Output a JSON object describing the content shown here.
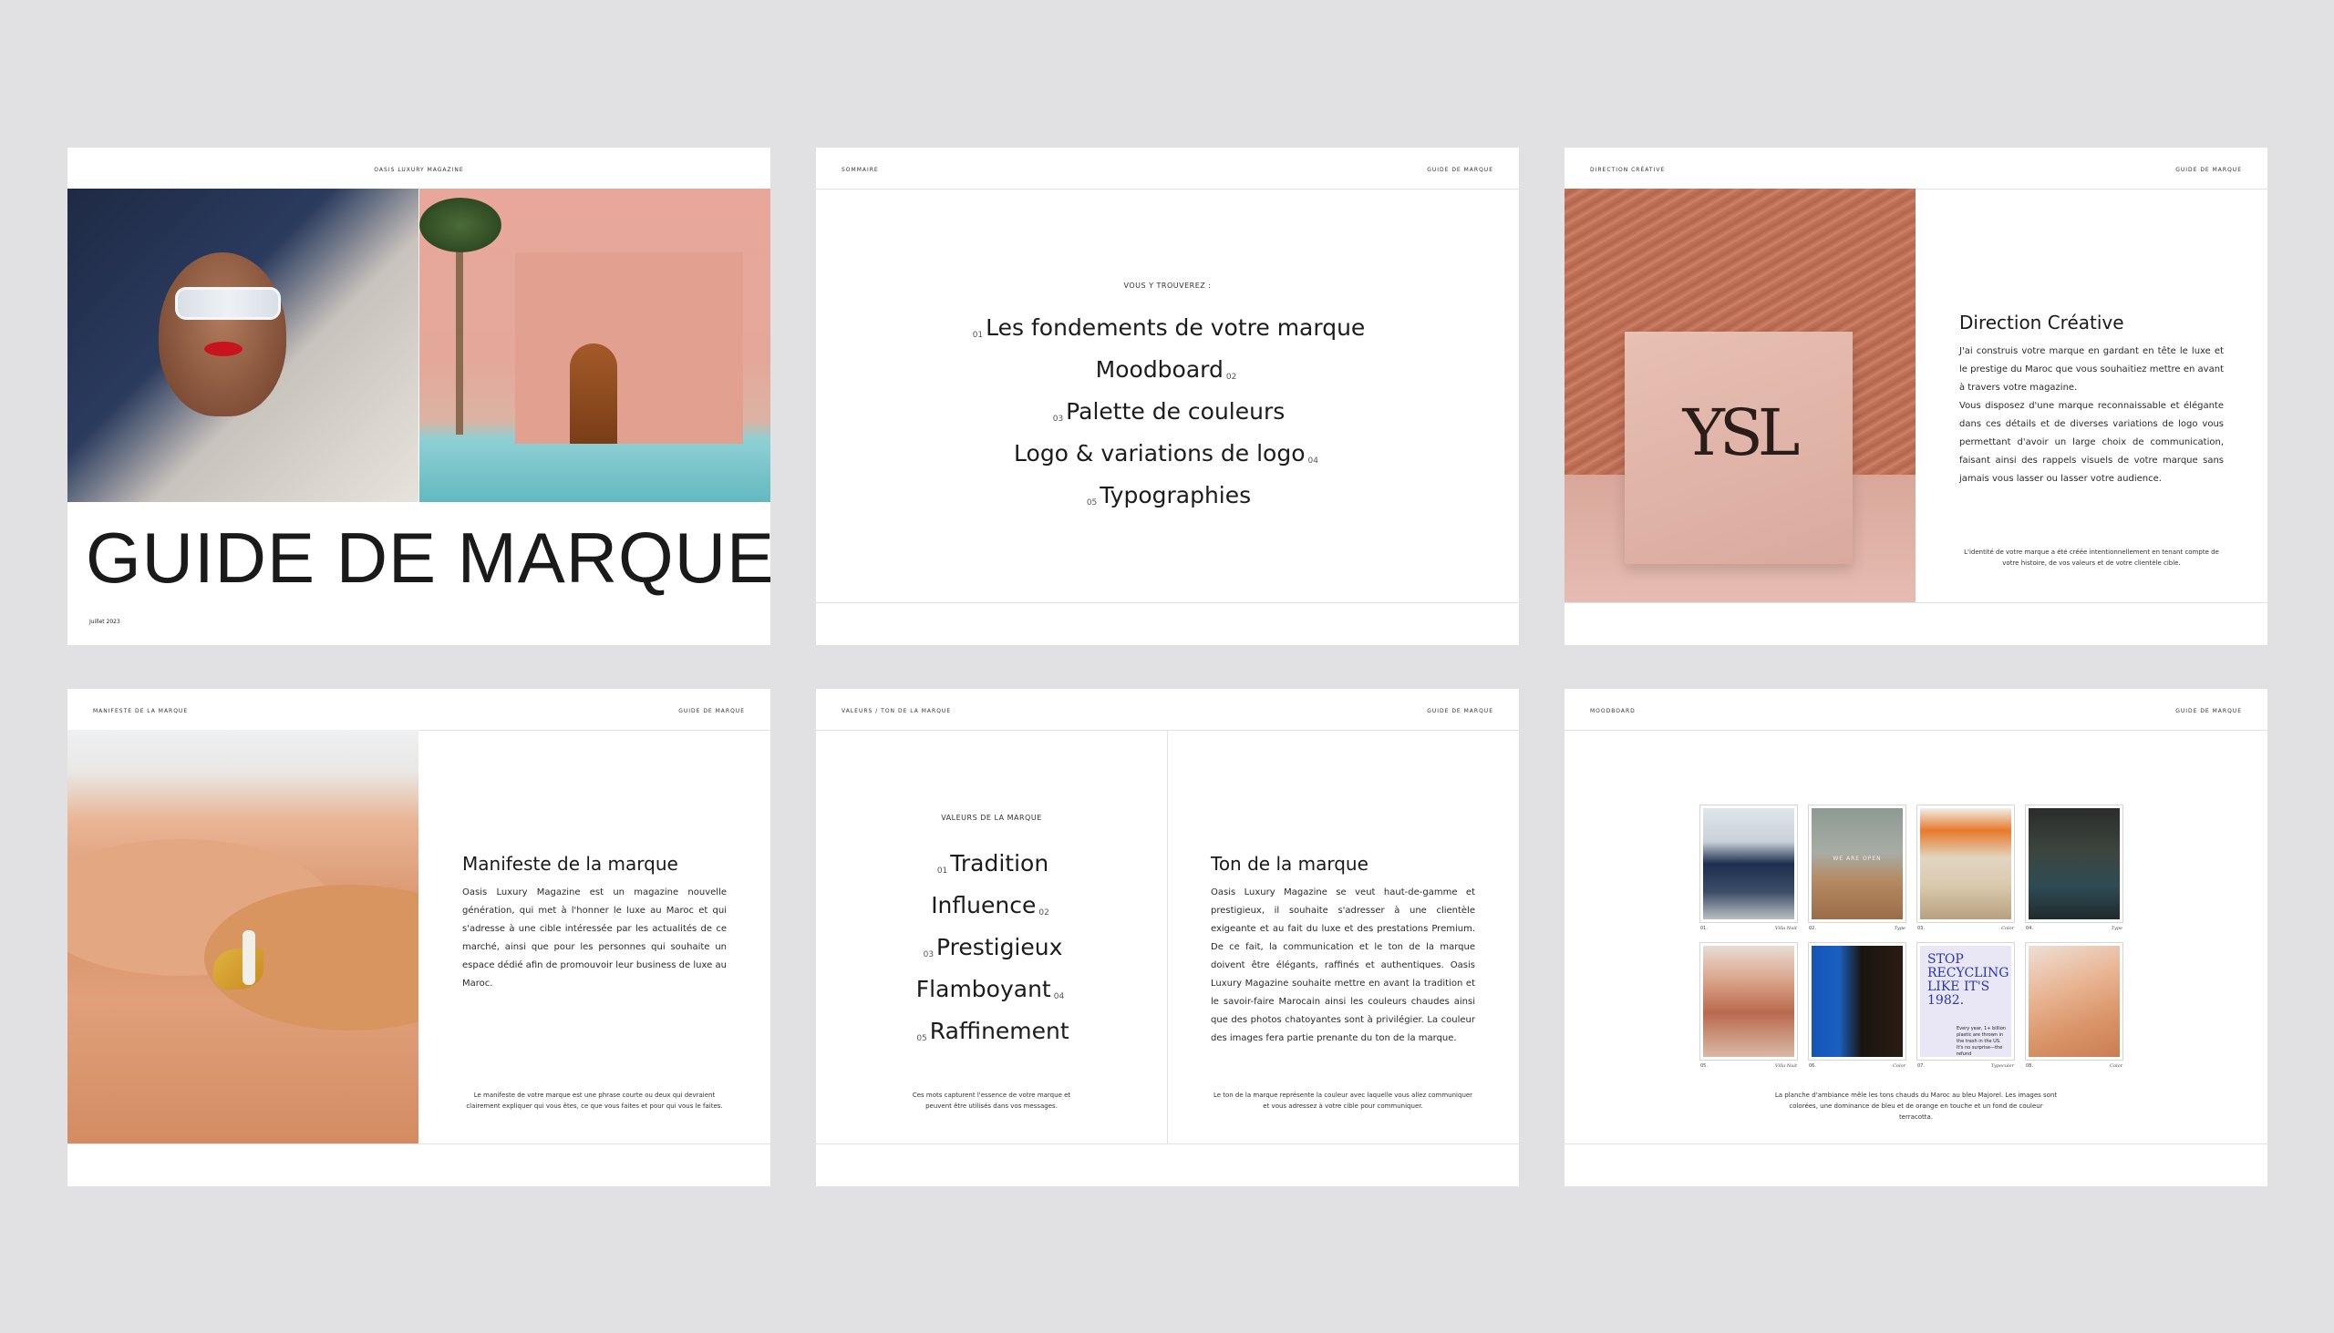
{
  "slide1": {
    "header": "OASIS LUXURY MAGAZINE",
    "title": "GUIDE DE MARQUE",
    "date": "Juillet 2023"
  },
  "slide2": {
    "header_left": "SOMMAIRE",
    "header_right": "GUIDE DE MARQUE",
    "eyebrow": "VOUS Y TROUVEREZ :",
    "items": [
      {
        "num": "01",
        "label": "Les fondements de votre marque"
      },
      {
        "num": "02",
        "label": "Moodboard"
      },
      {
        "num": "03",
        "label": "Palette de couleurs"
      },
      {
        "num": "04",
        "label": "Logo & variations de logo"
      },
      {
        "num": "05",
        "label": "Typographies"
      }
    ]
  },
  "slide3": {
    "header_left": "DIRECTION CRÉATIVE",
    "header_right": "GUIDE DE MARQUE",
    "title": "Direction Créative",
    "body1": "J'ai construis votre marque en gardant en tête le luxe et le prestige du Maroc que vous souhaitiez mettre en avant à travers votre magazine.",
    "body2": "Vous disposez d'une marque reconnaissable et élégante dans ces détails et de diverses variations de logo vous permettant d'avoir un large choix de communication, faisant ainsi des rappels visuels de votre marque sans jamais vous lasser ou lasser votre audience.",
    "note": "L'identité de votre marque a été créée intentionnellement en tenant compte de votre histoire, de vos valeurs et de votre clientèle cible.",
    "logo_text": "YSL"
  },
  "slide4": {
    "header_left": "MANIFESTE DE LA MARQUE",
    "header_right": "GUIDE DE MARQUE",
    "title": "Manifeste de la marque",
    "body": "Oasis Luxury Magazine est un magazine nouvelle génération, qui met à l'honner le luxe au Maroc et qui s'adresse à une cible intéressée par les actualités de ce marché, ainsi que pour les personnes qui souhaite un espace dédié afin de promouvoir leur business de luxe au Maroc.",
    "note": "Le manifeste de votre marque est une phrase courte ou deux qui devraient clairement expliquer qui vous êtes, ce que vous faites et pour qui vous le faites."
  },
  "slide5": {
    "header_left": "VALEURS / TON DE LA MARQUE",
    "header_right": "GUIDE DE MARQUE",
    "eyebrow": "VALEURS DE LA MARQUE",
    "values": [
      {
        "num": "01",
        "label": "Tradition"
      },
      {
        "num": "02",
        "label": "Influence"
      },
      {
        "num": "03",
        "label": "Prestigieux"
      },
      {
        "num": "04",
        "label": "Flamboyant"
      },
      {
        "num": "05",
        "label": "Raffinement"
      }
    ],
    "values_note": "Ces mots capturent l'essence de votre marque et peuvent être utilisés dans vos messages.",
    "title": "Ton de la marque",
    "body": "Oasis Luxury Magazine se veut haut-de-gamme et prestigieux, il souhaite s'adresser à une clientèle exigeante et au fait du luxe et des prestations Premium. De ce fait, la communication et le ton de la marque doivent être élégants, raffinés et authentiques. Oasis Luxury Magazine souhaite mettre en avant la tradition et le savoir-faire Marocain ainsi les couleurs chaudes ainsi que des photos chatoyantes sont à privilégier. La couleur des images fera partie prenante du ton de la marque.",
    "note": "Le ton de la marque représente la couleur avec laquelle vous allez communiquer et vous adressez à votre cible pour communiquer."
  },
  "slide6": {
    "header_left": "MOODBOARD",
    "header_right": "GUIDE DE MARQUE",
    "tiles": [
      {
        "num": "01.",
        "tag": "Villa Nuit"
      },
      {
        "num": "02.",
        "tag": "Type",
        "overlay": "WE ARE OPEN"
      },
      {
        "num": "03.",
        "tag": "Color"
      },
      {
        "num": "04.",
        "tag": "Type"
      },
      {
        "num": "05.",
        "tag": "Villa Nuit"
      },
      {
        "num": "06.",
        "tag": "Color"
      },
      {
        "num": "07.",
        "tag": "Typeculer",
        "poster": "STOP RECYCLING LIKE IT'S 1982.",
        "poster_small": "Every year, 1+ billion plastic are thrown in the trash in the US. It's no surprise—the refund"
      },
      {
        "num": "08.",
        "tag": "Color"
      }
    ],
    "note": "La planche d'ambiance mêle les tons chauds du Maroc au bleu Majorel. Les images sont colorées, une dominance de bleu et de orange en touche et un fond de couleur terracotta."
  }
}
